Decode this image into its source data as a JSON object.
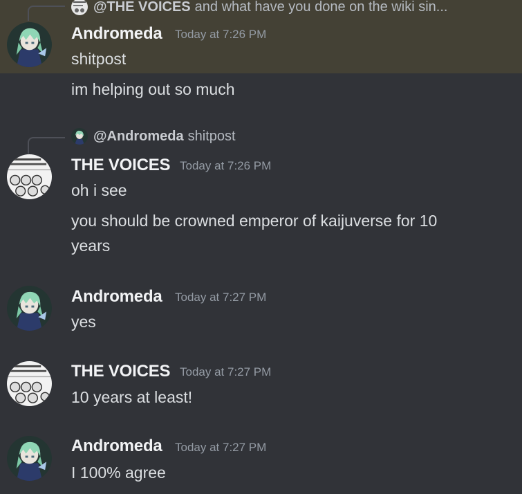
{
  "messages": {
    "m1": {
      "reply_mention": "@THE VOICES",
      "reply_text": "and what have you done on the wiki sin...",
      "author": "Andromeda",
      "timestamp": "Today at 7:26 PM",
      "lines": [
        "shitpost",
        "im helping out so much"
      ]
    },
    "m2": {
      "reply_mention": "@Andromeda",
      "reply_text": "shitpost",
      "author": "THE VOICES",
      "timestamp": "Today at 7:26 PM",
      "lines": [
        "oh i see",
        "you should be crowned emperor of kaijuverse for 10",
        "years"
      ]
    },
    "m3": {
      "author": "Andromeda",
      "timestamp": "Today at 7:27 PM",
      "lines": [
        "yes"
      ]
    },
    "m4": {
      "author": "THE VOICES",
      "timestamp": "Today at 7:27 PM",
      "lines": [
        "10 years at least!"
      ]
    },
    "m5": {
      "author": "Andromeda",
      "timestamp": "Today at 7:27 PM",
      "lines": [
        "I 100% agree"
      ]
    }
  },
  "colors": {
    "background": "#313338",
    "highlight": "#444135",
    "author": "#f2f3f5",
    "timestamp": "#949ba4",
    "text": "#dbdee1"
  },
  "icons": {
    "andromeda_avatar": "andromeda-avatar",
    "voices_avatar": "the-voices-avatar"
  }
}
